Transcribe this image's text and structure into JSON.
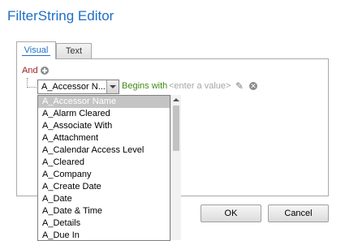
{
  "dialog": {
    "title": "FilterString Editor"
  },
  "tabs": [
    {
      "label": "Visual",
      "active": true
    },
    {
      "label": "Text",
      "active": false
    }
  ],
  "filter": {
    "group_operator": "And",
    "condition": {
      "field": "A_Accessor N...",
      "operator": "Begins with",
      "value_placeholder": "<enter a value>"
    }
  },
  "field_dropdown": {
    "selected": "A_Accessor Name",
    "options": [
      "A_Accessor Name",
      "A_Alarm Cleared",
      "A_Associate With",
      "A_Attachment",
      "A_Calendar Access Level",
      "A_Cleared",
      "A_Company",
      "A_Create Date",
      "A_Date",
      "A_Date & Time",
      "A_Details",
      "A_Due In"
    ]
  },
  "buttons": {
    "ok": "OK",
    "cancel": "Cancel"
  },
  "icons": {
    "add": "plus-circle-icon",
    "edit": "pencil-icon",
    "remove": "close-circle-icon",
    "dropdown": "chevron-down-icon"
  },
  "colors": {
    "title": "#1e6fc5",
    "group_operator": "#9a1c1c",
    "operator": "#3e8a13",
    "placeholder": "#a6a6a6",
    "selected_option_bg": "#c4c4c4"
  }
}
